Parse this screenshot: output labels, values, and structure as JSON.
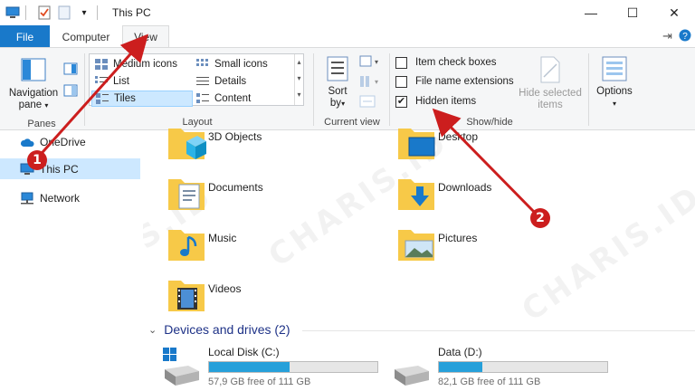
{
  "window": {
    "title": "This PC",
    "controls": {
      "minimize": "—",
      "maximize": "☐",
      "close": "✕"
    }
  },
  "ribbon_tabs": {
    "file": "File",
    "computer": "Computer",
    "view": "View",
    "active": "View"
  },
  "panes_group": {
    "label": "Panes",
    "navigation_pane_line1": "Navigation",
    "navigation_pane_line2": "pane"
  },
  "layout_group": {
    "label": "Layout",
    "items": [
      {
        "label": "Medium icons"
      },
      {
        "label": "Small icons"
      },
      {
        "label": "List"
      },
      {
        "label": "Details"
      },
      {
        "label": "Tiles",
        "selected": true
      },
      {
        "label": "Content"
      }
    ]
  },
  "current_view_group": {
    "label": "Current view",
    "sort_line1": "Sort",
    "sort_line2": "by"
  },
  "show_hide_group": {
    "label": "Show/hide",
    "item_check_boxes": {
      "label": "Item check boxes",
      "checked": false
    },
    "file_name_extensions": {
      "label": "File name extensions",
      "checked": false
    },
    "hidden_items": {
      "label": "Hidden items",
      "checked": true
    },
    "hide_selected_line1": "Hide selected",
    "hide_selected_line2": "items"
  },
  "options_group": {
    "label": "Options"
  },
  "nav_pane": {
    "items": [
      {
        "label": "OneDrive"
      },
      {
        "label": "This PC",
        "selected": true
      },
      {
        "label": "Network"
      }
    ]
  },
  "folders": [
    {
      "name": "3D Objects"
    },
    {
      "name": "Desktop"
    },
    {
      "name": "Documents"
    },
    {
      "name": "Downloads"
    },
    {
      "name": "Music"
    },
    {
      "name": "Pictures"
    },
    {
      "name": "Videos"
    }
  ],
  "devices": {
    "heading": "Devices and drives (2)",
    "drives": [
      {
        "name": "Local Disk (C:)",
        "free_text": "57,9 GB free of 111 GB",
        "used_fraction": 0.48
      },
      {
        "name": "Data (D:)",
        "free_text": "82,1 GB free of 111 GB",
        "used_fraction": 0.26
      }
    ]
  },
  "annotations": {
    "badge1": "1",
    "badge2": "2",
    "watermark": "CHARIS.ID",
    "color": "#cc1e1e"
  },
  "colors": {
    "accent": "#1979ca",
    "selection": "#cce8ff",
    "drive_fill": "#26a0da",
    "folder_yellow": "#f7c948"
  }
}
